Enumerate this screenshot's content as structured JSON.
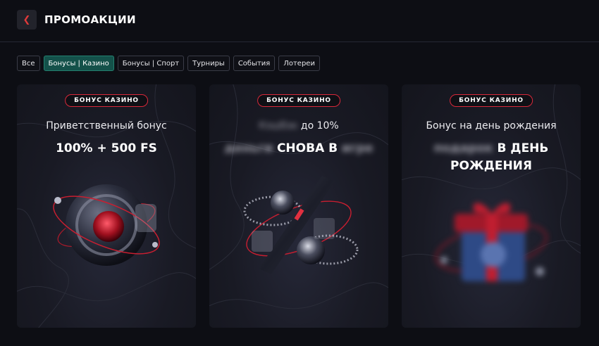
{
  "header": {
    "back_icon": "chevron-left-icon",
    "title": "ПРОМОАКЦИИ"
  },
  "filters": [
    {
      "label": "Все",
      "active": false
    },
    {
      "label": "Бонусы | Казино",
      "active": true
    },
    {
      "label": "Бонусы | Спорт",
      "active": false
    },
    {
      "label": "Турниры",
      "active": false
    },
    {
      "label": "События",
      "active": false
    },
    {
      "label": "Лотереи",
      "active": false
    }
  ],
  "cards": [
    {
      "badge": "БОНУС КАЗИНО",
      "subtitle": "Приветственный бонус",
      "title": "100% + 500 FS"
    },
    {
      "badge": "БОНУС КАЗИНО",
      "subtitle_blur": "Кэшбэк",
      "subtitle": "до 10%",
      "title_blur_a": "деньги",
      "title": "СНОВА В",
      "title_blur_b": "игре"
    },
    {
      "badge": "БОНУС КАЗИНО",
      "subtitle": "Бонус на день рождения",
      "title_blur": "подарок",
      "title_line1": "В ДЕНЬ",
      "title_line2": "РОЖДЕНИЯ"
    }
  ],
  "colors": {
    "accent_red": "#d9283a",
    "active_chip": "#14514a",
    "background": "#0d0e14"
  }
}
